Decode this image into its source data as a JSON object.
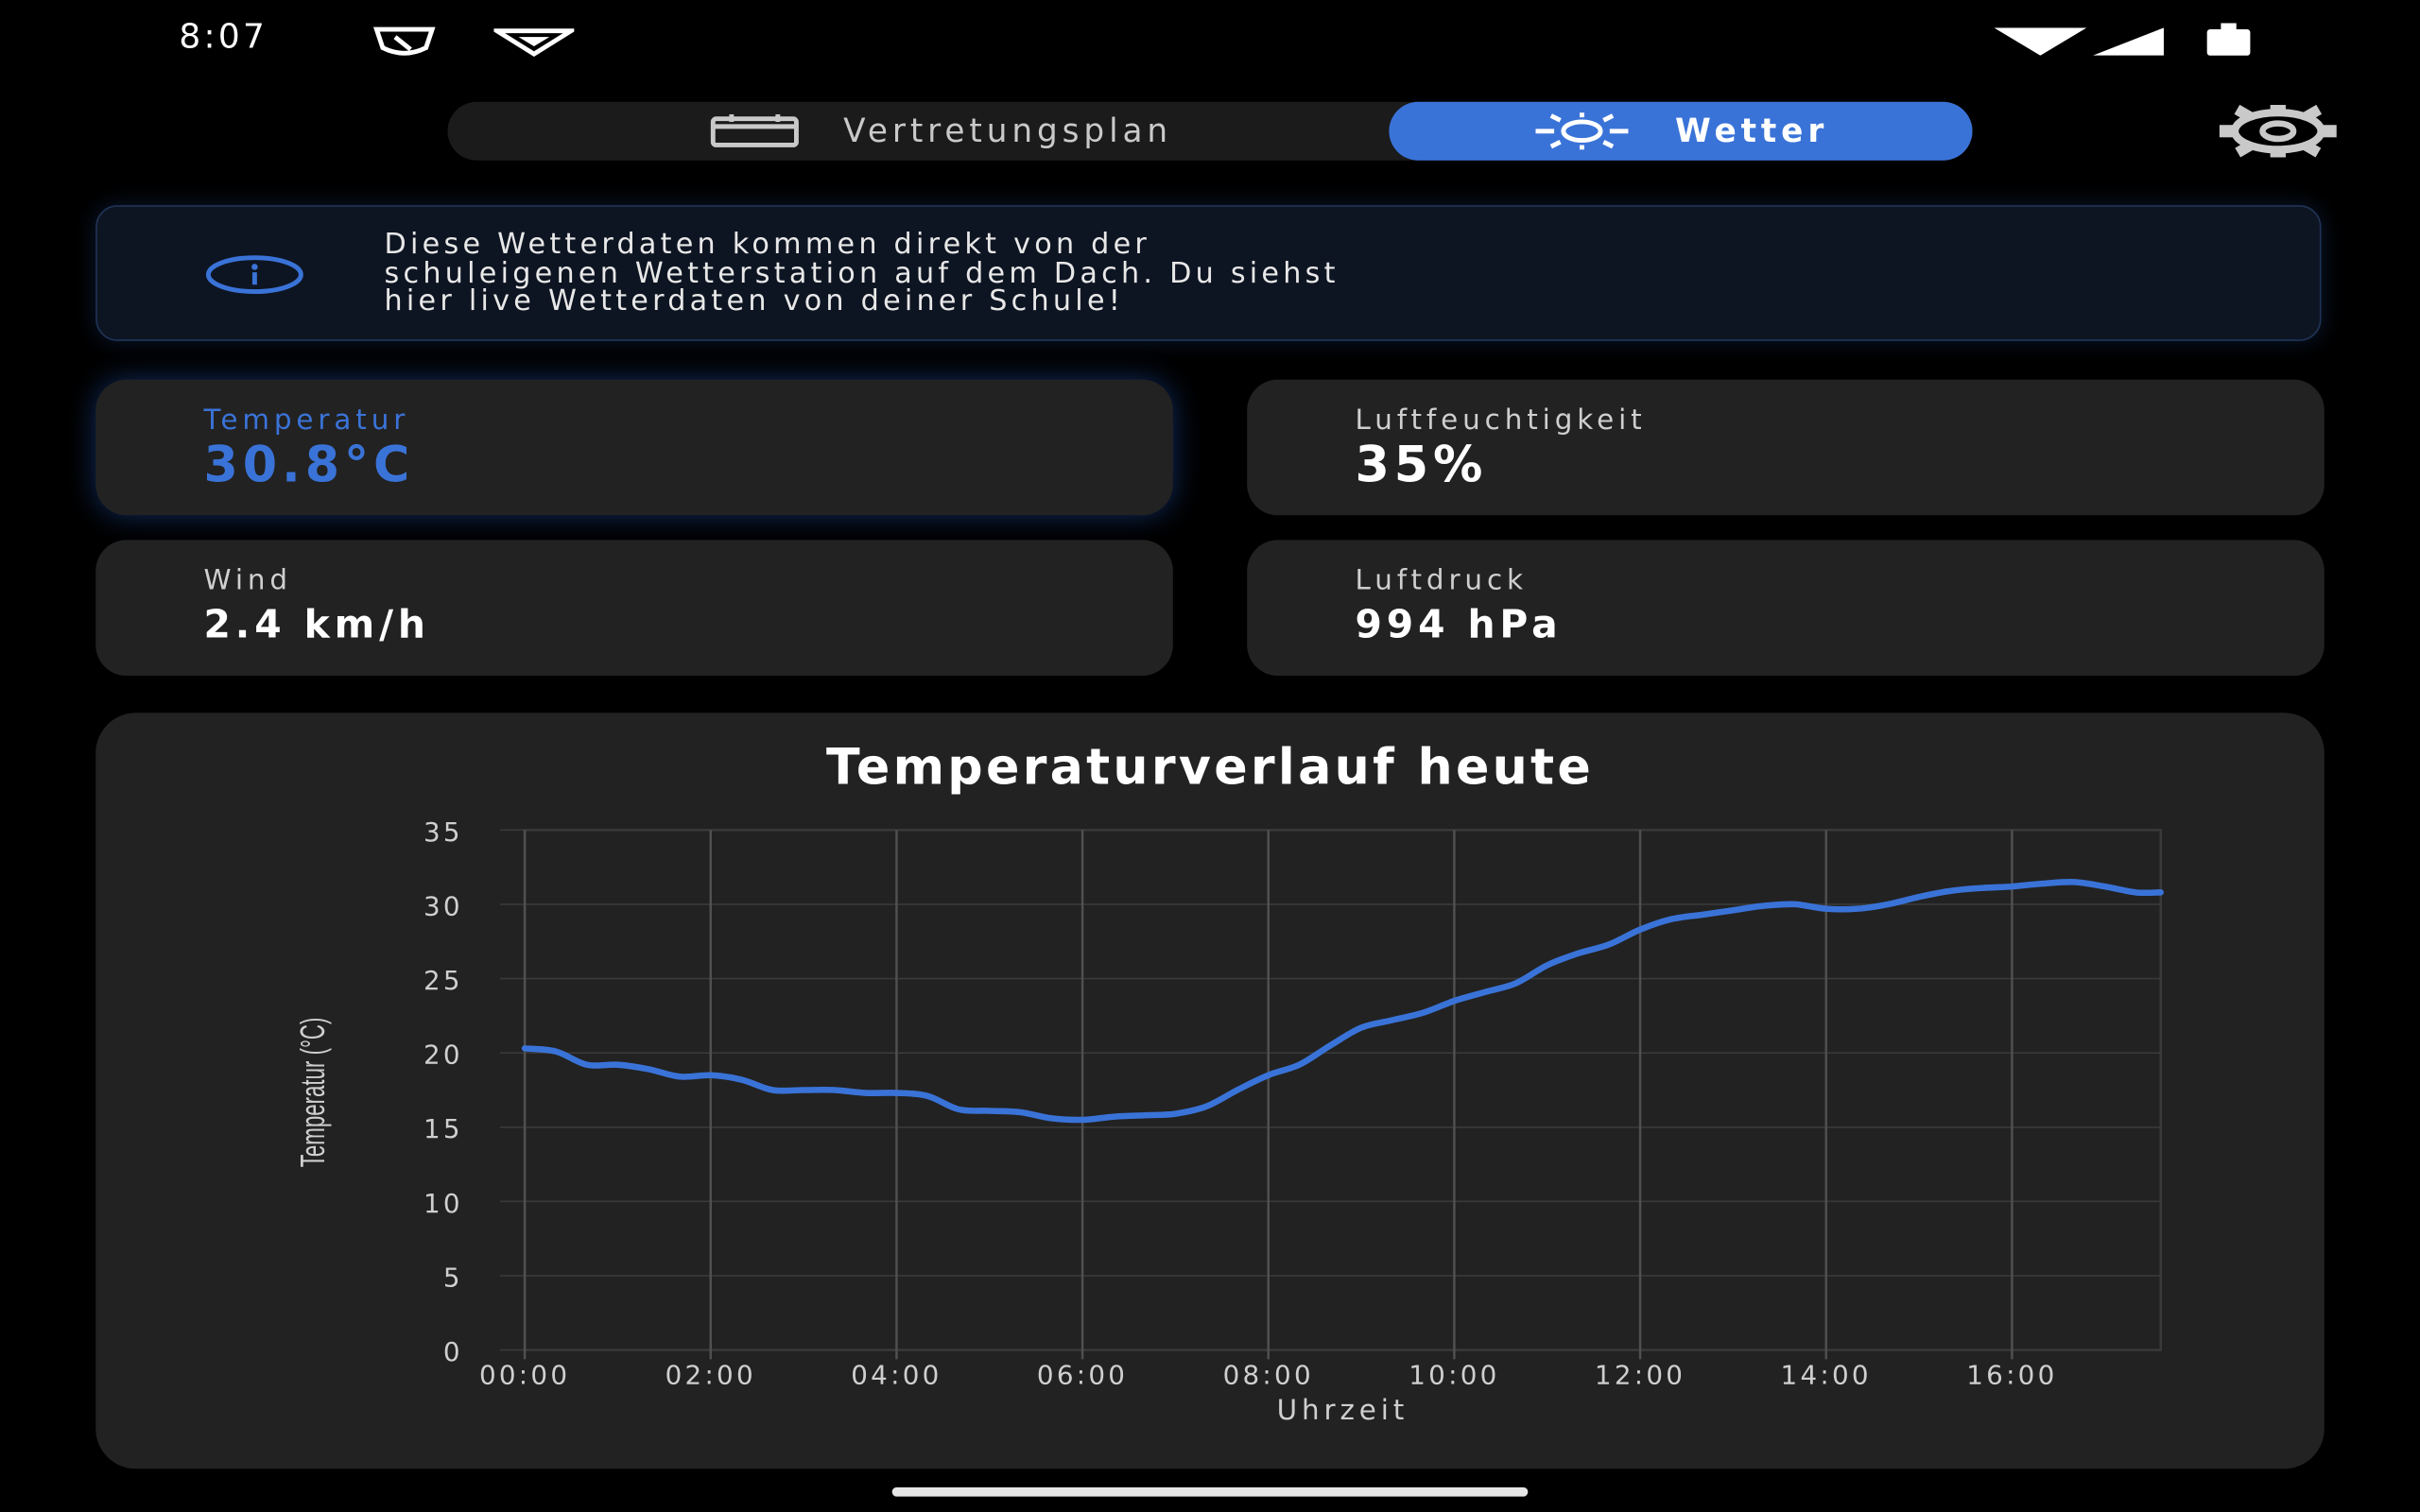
{
  "status_bar": {
    "time": "8:07",
    "icons": [
      "shield-icon",
      "vpn-icon",
      "wifi-icon",
      "signal-icon",
      "battery-icon"
    ]
  },
  "tabs": [
    {
      "label": "Vertretungsplan",
      "icon": "calendar-icon",
      "active": false
    },
    {
      "label": "Wetter",
      "icon": "sun-icon",
      "active": true
    }
  ],
  "settings_icon": "gear-icon",
  "info_banner": {
    "icon": "info-icon",
    "text": "Diese Wetterdaten kommen direkt von der\nschuleigenen Wetterstation auf dem Dach. Du siehst\nhier live Wetterdaten von deiner Schule!"
  },
  "metrics": [
    {
      "label": "Temperatur",
      "value": "30.8°C",
      "highlighted": true
    },
    {
      "label": "Luftfeuchtigkeit",
      "value": "35%",
      "highlighted": false
    },
    {
      "label": "Wind",
      "value": "2.4 km/h",
      "highlighted": false
    },
    {
      "label": "Luftdruck",
      "value": "994 hPa",
      "highlighted": false
    }
  ],
  "colors": {
    "accent": "#3a73d8",
    "background": "#000000",
    "card": "#222222",
    "banner": "#0e1522"
  },
  "chart_data": {
    "type": "line",
    "title": "Temperaturverlauf heute",
    "xlabel": "Uhrzeit",
    "ylabel": "Temperatur (°C)",
    "x_tick_labels": [
      "00:00",
      "02:00",
      "04:00",
      "06:00",
      "08:00",
      "10:00",
      "12:00",
      "14:00",
      "16:00"
    ],
    "y_tick_labels": [
      "0",
      "5",
      "10",
      "15",
      "20",
      "25",
      "30",
      "35"
    ],
    "xlim": [
      "00:00",
      "17:36"
    ],
    "ylim": [
      0,
      35
    ],
    "grid": true,
    "series": [
      {
        "x": [
          "00:00",
          "00:20",
          "00:40",
          "01:00",
          "01:20",
          "01:40",
          "02:00",
          "02:20",
          "02:40",
          "03:00",
          "03:20",
          "03:40",
          "04:00",
          "04:20",
          "04:40",
          "05:00",
          "05:20",
          "05:40",
          "06:00",
          "06:20",
          "06:40",
          "07:00",
          "07:20",
          "07:40",
          "08:00",
          "08:20",
          "08:40",
          "09:00",
          "09:20",
          "09:40",
          "10:00",
          "10:20",
          "10:40",
          "11:00",
          "11:20",
          "11:40",
          "12:00",
          "12:20",
          "12:40",
          "13:00",
          "13:20",
          "13:40",
          "14:00",
          "14:20",
          "14:40",
          "15:00",
          "15:20",
          "15:40",
          "16:00",
          "16:20",
          "16:40",
          "17:00",
          "17:20",
          "17:36"
        ],
        "values": [
          20.3,
          20.1,
          19.2,
          19.2,
          18.9,
          18.4,
          18.5,
          18.2,
          17.5,
          17.5,
          17.5,
          17.3,
          17.3,
          17.1,
          16.2,
          16.1,
          16.0,
          15.6,
          15.5,
          15.7,
          15.8,
          15.9,
          16.4,
          17.5,
          18.5,
          19.2,
          20.5,
          21.7,
          22.2,
          22.7,
          23.5,
          24.1,
          24.7,
          25.9,
          26.7,
          27.3,
          28.3,
          29.0,
          29.3,
          29.6,
          29.9,
          30.0,
          29.7,
          29.7,
          30.0,
          30.5,
          30.9,
          31.1,
          31.2,
          31.4,
          31.5,
          31.2,
          30.8,
          30.8
        ]
      }
    ]
  }
}
